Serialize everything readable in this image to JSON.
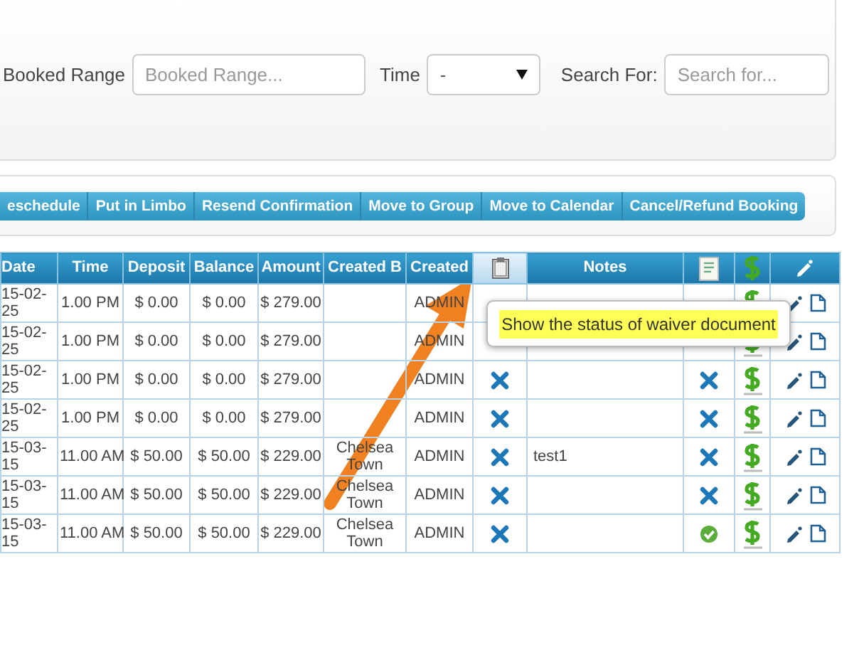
{
  "filters": [
    {
      "label": "Booked Range",
      "kind": "text",
      "placeholder": "Booked Range..."
    },
    {
      "label": "Time",
      "kind": "select",
      "value": "-"
    },
    {
      "label": "Search For:",
      "kind": "text",
      "placeholder": "Search for..."
    }
  ],
  "actions": [
    "eschedule",
    "Put in Limbo",
    "Resend Confirmation",
    "Move to Group",
    "Move to Calendar",
    "Cancel/Refund Booking"
  ],
  "table": {
    "columns": [
      {
        "kind": "text",
        "label": "Date",
        "highlighted": false
      },
      {
        "kind": "text",
        "label": "Time",
        "highlighted": false
      },
      {
        "kind": "text",
        "label": "Deposit",
        "highlighted": false
      },
      {
        "kind": "text",
        "label": "Balance",
        "highlighted": false
      },
      {
        "kind": "text",
        "label": "Amount",
        "highlighted": false
      },
      {
        "kind": "text",
        "label": "Created B",
        "highlighted": false
      },
      {
        "kind": "text",
        "label": "Created",
        "highlighted": false
      },
      {
        "kind": "icon",
        "highlighted": true
      },
      {
        "kind": "text",
        "label": "Notes",
        "highlighted": false
      },
      {
        "kind": "icon",
        "highlighted": false
      },
      {
        "kind": "icon",
        "highlighted": false
      },
      {
        "kind": "icon",
        "highlighted": false
      }
    ],
    "rows": [
      {
        "date": "15-02-25",
        "time": "1.00 PM",
        "deposit": "$ 0.00",
        "balance": "$ 0.00",
        "amount": "$ 279.00",
        "created": "ADMIN"
      },
      {
        "date": "15-02-25",
        "time": "1.00 PM",
        "deposit": "$ 0.00",
        "balance": "$ 0.00",
        "amount": "$ 279.00",
        "created": "ADMIN"
      },
      {
        "date": "15-02-25",
        "time": "1.00 PM",
        "deposit": "$ 0.00",
        "balance": "$ 0.00",
        "amount": "$ 279.00",
        "created": "ADMIN",
        "waiver_signed": false,
        "form_signed": false
      },
      {
        "date": "15-02-25",
        "time": "1.00 PM",
        "deposit": "$ 0.00",
        "balance": "$ 0.00",
        "amount": "$ 279.00",
        "created": "ADMIN",
        "waiver_signed": false,
        "form_signed": false
      },
      {
        "date": "15-03-15",
        "time": "11.00 AM",
        "deposit": "$ 50.00",
        "balance": "$ 50.00",
        "amount": "$ 229.00",
        "created_by": "Chelsea Town",
        "created": "ADMIN",
        "waiver_signed": false,
        "notes": "test1",
        "form_signed": false
      },
      {
        "date": "15-03-15",
        "time": "11.00 AM",
        "deposit": "$ 50.00",
        "balance": "$ 50.00",
        "amount": "$ 229.00",
        "created_by": "Chelsea Town",
        "created": "ADMIN",
        "waiver_signed": false,
        "form_signed": false
      },
      {
        "date": "15-03-15",
        "time": "11.00 AM",
        "deposit": "$ 50.00",
        "balance": "$ 50.00",
        "amount": "$ 229.00",
        "created_by": "Chelsea Town",
        "created": "ADMIN",
        "waiver_signed": false,
        "form_signed": true
      }
    ]
  },
  "tooltip": {
    "text": "Show the status of waiver document"
  }
}
